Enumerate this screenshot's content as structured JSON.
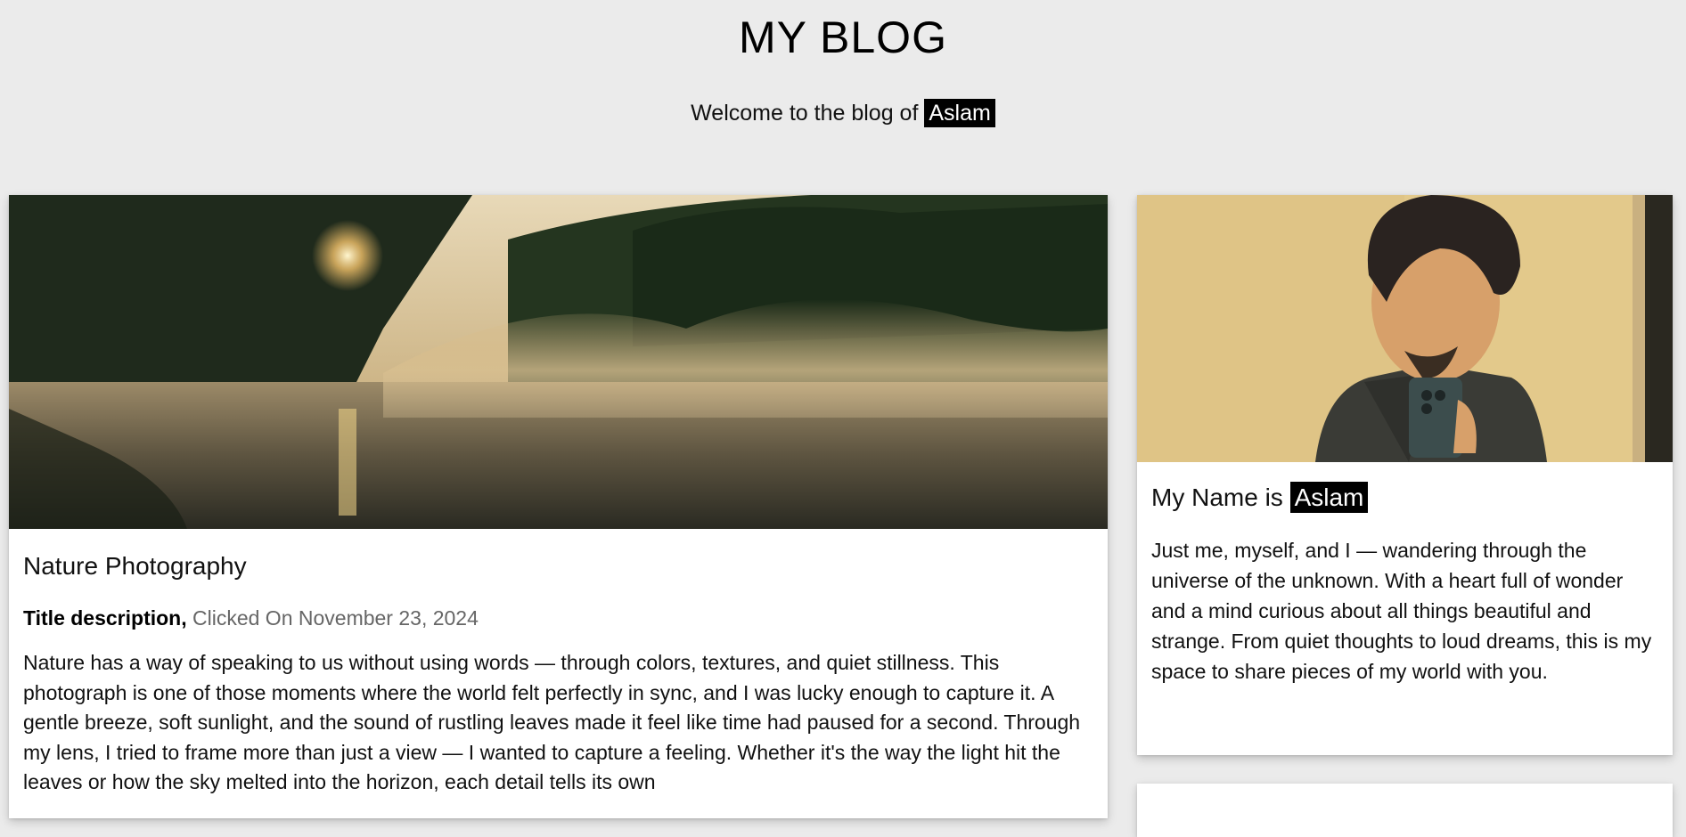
{
  "header": {
    "title": "MY BLOG",
    "welcome_prefix": "Welcome to the blog of",
    "author_tag": "Aslam"
  },
  "main_post": {
    "image": "mist-lake-photo",
    "title": "Nature Photography",
    "meta_label": "Title description,",
    "meta_date": "Clicked On November 23, 2024",
    "body": "Nature has a way of speaking to us without using words — through colors, textures, and quiet stillness. This photograph is one of those moments where the world felt perfectly in sync, and I was lucky enough to capture it. A gentle breeze, soft sunlight, and the sound of rustling leaves made it feel like time had paused for a second. Through my lens, I tried to frame more than just a view — I wanted to capture a feeling. Whether it's the way the light hit the leaves or how the sky melted into the horizon, each detail tells its own"
  },
  "about": {
    "image": "author-portrait",
    "title_prefix": "My Name is",
    "name_tag": "Aslam",
    "body": "Just me, myself, and I — wandering through the universe of the unknown. With a heart full of wonder and a mind curious about all things beautiful and strange. From quiet thoughts to loud dreams, this is my space to share pieces of my world with you."
  },
  "colors": {
    "background": "#ebebeb",
    "tag_bg": "#000000",
    "tag_fg": "#ffffff",
    "date_gray": "#666666"
  }
}
